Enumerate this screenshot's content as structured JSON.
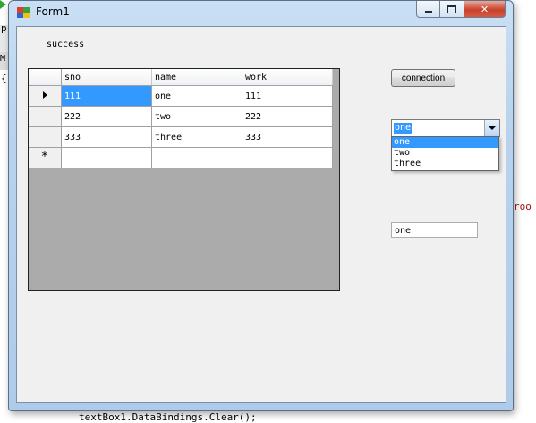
{
  "background_editor": {
    "fragments": [
      "p",
      "{",
      "M",
      "roo",
      "textBox1.DataBindings.Clear();"
    ]
  },
  "window": {
    "title": "Form1",
    "minimize_glyph": "",
    "maximize_glyph": "",
    "close_glyph": "✕"
  },
  "form": {
    "status_label": "success",
    "connection_button": "connection",
    "grid": {
      "columns": [
        "sno",
        "name",
        "work"
      ],
      "rows": [
        [
          "111",
          "one",
          "111"
        ],
        [
          "222",
          "two",
          "222"
        ],
        [
          "333",
          "three",
          "333"
        ]
      ],
      "new_row_marker": "*"
    },
    "combo": {
      "selected": "one",
      "options": [
        "one",
        "two",
        "three"
      ],
      "highlighted": "one"
    },
    "textbox_value": "one"
  },
  "colors": {
    "selection": "#3399ff",
    "grid_background": "#ababab",
    "client_background": "#f0f0f0"
  }
}
